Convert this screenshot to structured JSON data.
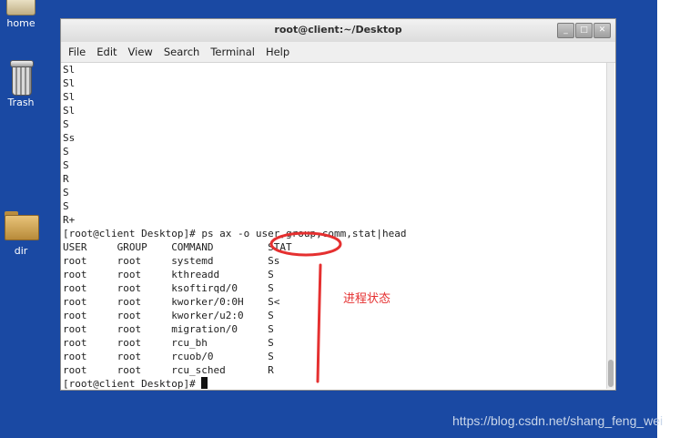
{
  "desktop": {
    "icons": [
      {
        "label": "home",
        "icon": "home-folder-icon"
      },
      {
        "label": "Trash",
        "icon": "trash-icon"
      },
      {
        "label": "dir",
        "icon": "folder-icon"
      }
    ],
    "watermark": "https://blog.csdn.net/shang_feng_wei"
  },
  "window": {
    "title": "root@client:~/Desktop",
    "buttons": {
      "minimize": "_",
      "maximize": "□",
      "close": "✕"
    }
  },
  "menu": [
    "File",
    "Edit",
    "View",
    "Search",
    "Terminal",
    "Help"
  ],
  "terminal": {
    "stat_lines": [
      "Sl",
      "Sl",
      "Sl",
      "Sl",
      "S",
      "Ss",
      "S",
      "S",
      "R",
      "S",
      "S",
      "R+"
    ],
    "command_line": "[root@client Desktop]# ps ax -o user,group,comm,stat|head",
    "table": {
      "headers": [
        "USER",
        "GROUP",
        "COMMAND",
        "STAT"
      ],
      "rows": [
        [
          "root",
          "root",
          "systemd",
          "Ss"
        ],
        [
          "root",
          "root",
          "kthreadd",
          "S"
        ],
        [
          "root",
          "root",
          "ksoftirqd/0",
          "S"
        ],
        [
          "root",
          "root",
          "kworker/0:0H",
          "S<"
        ],
        [
          "root",
          "root",
          "kworker/u2:0",
          "S"
        ],
        [
          "root",
          "root",
          "migration/0",
          "S"
        ],
        [
          "root",
          "root",
          "rcu_bh",
          "S"
        ],
        [
          "root",
          "root",
          "rcuob/0",
          "S"
        ],
        [
          "root",
          "root",
          "rcu_sched",
          "R"
        ]
      ]
    },
    "prompt": "[root@client Desktop]# "
  },
  "annotation": {
    "label": "进程状态",
    "color": "#e53030"
  }
}
